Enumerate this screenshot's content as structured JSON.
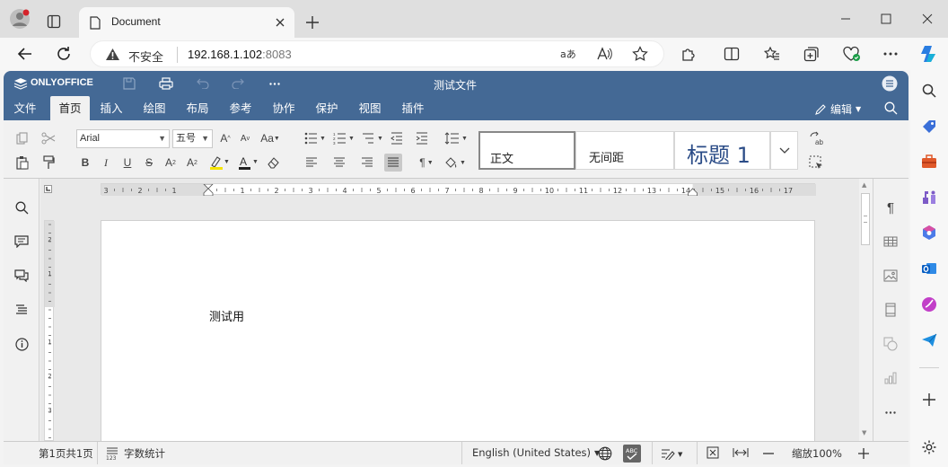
{
  "browser": {
    "tab_title": "Document",
    "security_label": "不安全",
    "url_host": "192.168.1.102",
    "url_port": ":8083"
  },
  "onlyoffice": {
    "brand": "ONLYOFFICE",
    "doc_title": "测试文件",
    "menu_tabs": [
      "文件",
      "首页",
      "插入",
      "绘图",
      "布局",
      "参考",
      "协作",
      "保护",
      "视图",
      "插件"
    ],
    "active_tab": "首页",
    "edit_mode_label": "编辑",
    "font_name": "Arial",
    "font_size": "五号",
    "styles": [
      "正文",
      "无间距",
      "标题 1"
    ],
    "document_text": "测试用",
    "status": {
      "page_info": "第1页共1页",
      "word_count": "字数统计",
      "language": "English (United States)",
      "zoom": "缩放100%"
    },
    "ruler_numbers": [
      "3",
      "2",
      "1",
      "1",
      "2",
      "3",
      "4",
      "5",
      "6",
      "7",
      "8",
      "9",
      "10",
      "11",
      "12",
      "13",
      "14",
      "15",
      "16",
      "17"
    ],
    "vruler_numbers": [
      "2",
      "1",
      "1",
      "2",
      "3"
    ]
  },
  "colors": {
    "header_blue": "#446995",
    "heading_blue": "#2b4c87"
  }
}
